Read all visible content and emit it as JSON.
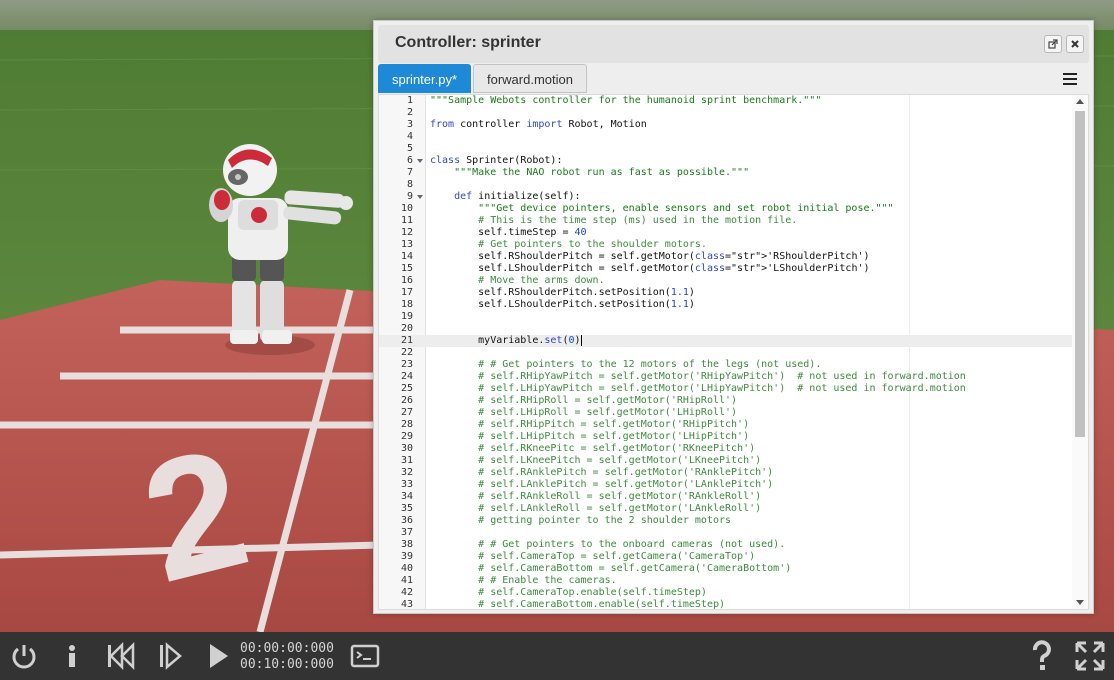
{
  "editor": {
    "title": "Controller: sprinter",
    "tabs": [
      {
        "label": "sprinter.py*",
        "active": true
      },
      {
        "label": "forward.motion",
        "active": false
      }
    ],
    "active_line": 21,
    "code_lines": [
      {
        "n": "1",
        "t": "\"\"\"Sample Webots controller for the humanoid sprint benchmark.\"\"\""
      },
      {
        "n": "2",
        "t": ""
      },
      {
        "n": "3",
        "t": "from controller import Robot, Motion"
      },
      {
        "n": "4",
        "t": ""
      },
      {
        "n": "5",
        "t": ""
      },
      {
        "n": "6",
        "t": "class Sprinter(Robot):"
      },
      {
        "n": "7",
        "t": "    \"\"\"Make the NAO robot run as fast as possible.\"\"\""
      },
      {
        "n": "8",
        "t": ""
      },
      {
        "n": "9",
        "t": "    def initialize(self):"
      },
      {
        "n": "10",
        "t": "        \"\"\"Get device pointers, enable sensors and set robot initial pose.\"\"\""
      },
      {
        "n": "11",
        "t": "        # This is the time step (ms) used in the motion file."
      },
      {
        "n": "12",
        "t": "        self.timeStep = 40"
      },
      {
        "n": "13",
        "t": "        # Get pointers to the shoulder motors."
      },
      {
        "n": "14",
        "t": "        self.RShoulderPitch = self.getMotor('RShoulderPitch')"
      },
      {
        "n": "15",
        "t": "        self.LShoulderPitch = self.getMotor('LShoulderPitch')"
      },
      {
        "n": "16",
        "t": "        # Move the arms down."
      },
      {
        "n": "17",
        "t": "        self.RShoulderPitch.setPosition(1.1)"
      },
      {
        "n": "18",
        "t": "        self.LShoulderPitch.setPosition(1.1)"
      },
      {
        "n": "19",
        "t": ""
      },
      {
        "n": "20",
        "t": ""
      },
      {
        "n": "21",
        "t": "        myVariable.set(0)"
      },
      {
        "n": "22",
        "t": ""
      },
      {
        "n": "23",
        "t": "        # # Get pointers to the 12 motors of the legs (not used)."
      },
      {
        "n": "24",
        "t": "        # self.RHipYawPitch = self.getMotor('RHipYawPitch')  # not used in forward.motion"
      },
      {
        "n": "25",
        "t": "        # self.LHipYawPitch = self.getMotor('LHipYawPitch')  # not used in forward.motion"
      },
      {
        "n": "26",
        "t": "        # self.RHipRoll = self.getMotor('RHipRoll')"
      },
      {
        "n": "27",
        "t": "        # self.LHipRoll = self.getMotor('LHipRoll')"
      },
      {
        "n": "28",
        "t": "        # self.RHipPitch = self.getMotor('RHipPitch')"
      },
      {
        "n": "29",
        "t": "        # self.LHipPitch = self.getMotor('LHipPitch')"
      },
      {
        "n": "30",
        "t": "        # self.RKneePitc = self.getMotor('RKneePitch')"
      },
      {
        "n": "31",
        "t": "        # self.LKneePitch = self.getMotor('LKneePitch')"
      },
      {
        "n": "32",
        "t": "        # self.RAnklePitch = self.getMotor('RAnklePitch')"
      },
      {
        "n": "33",
        "t": "        # self.LAnklePitch = self.getMotor('LAnklePitch')"
      },
      {
        "n": "34",
        "t": "        # self.RAnkleRoll = self.getMotor('RAnkleRoll')"
      },
      {
        "n": "35",
        "t": "        # self.LAnkleRoll = self.getMotor('LAnkleRoll')"
      },
      {
        "n": "36",
        "t": "        # getting pointer to the 2 shoulder motors"
      },
      {
        "n": "37",
        "t": ""
      },
      {
        "n": "38",
        "t": "        # # Get pointers to the onboard cameras (not used)."
      },
      {
        "n": "39",
        "t": "        # self.CameraTop = self.getCamera('CameraTop')"
      },
      {
        "n": "40",
        "t": "        # self.CameraBottom = self.getCamera('CameraBottom')"
      },
      {
        "n": "41",
        "t": "        # # Enable the cameras."
      },
      {
        "n": "42",
        "t": "        # self.CameraTop.enable(self.timeStep)"
      },
      {
        "n": "43",
        "t": "        # self.CameraBottom.enable(self.timeStep)"
      }
    ]
  },
  "toolbar": {
    "time_current": "00:00:00:000",
    "time_limit": "00:10:00:000",
    "icons": [
      "power-icon",
      "info-icon",
      "reset-icon",
      "step-icon",
      "play-icon",
      "console-icon",
      "help-icon",
      "fullscreen-icon"
    ]
  },
  "scene": {
    "track_lane_number": "2",
    "colors": {
      "track": "#b7514b",
      "grass": "#5f8a3d",
      "toolbar": "#333333",
      "tab_active": "#1d89d7"
    }
  }
}
